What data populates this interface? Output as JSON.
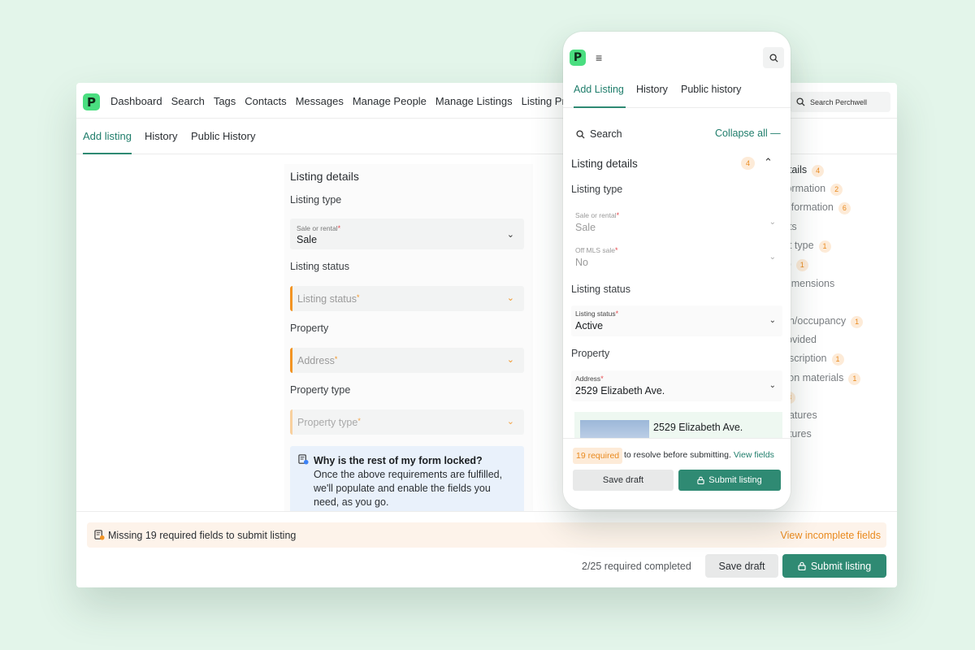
{
  "desktop": {
    "logo_letter": "P",
    "nav": [
      "Dashboard",
      "Search",
      "Tags",
      "Contacts",
      "Messages",
      "Manage People",
      "Manage Listings",
      "Listing Pres"
    ],
    "search_placeholder": "Search Perchwell",
    "tabs": [
      "Add listing",
      "History",
      "Public History"
    ],
    "form": {
      "heading": "Listing details",
      "listing_type_label": "Listing type",
      "sale_or_rental_small": "Sale or rental",
      "sale_or_rental_value": "Sale",
      "listing_status_label": "Listing status",
      "listing_status_placeholder": "Listing status",
      "property_label": "Property",
      "address_placeholder": "Address",
      "property_type_label": "Property type",
      "property_type_placeholder": "Property type",
      "info_title": "Why is the rest of my form locked?",
      "info_body": "Once the above requirements are fulfilled, we'll populate and enable the fields you need, as you go."
    },
    "right_list": [
      {
        "label": "etails",
        "badge": "4"
      },
      {
        "label": "formation",
        "badge": "2"
      },
      {
        "label": "information",
        "badge": "6"
      },
      {
        "label": "nts",
        "badge": ""
      },
      {
        "label": "nt type",
        "badge": "1"
      },
      {
        "label": "ip",
        "badge": "1"
      },
      {
        "label": "dimensions",
        "badge": ""
      },
      {
        "label": "on/occupancy",
        "badge": "1"
      },
      {
        "label": "rovided",
        "badge": ""
      },
      {
        "label": "escription",
        "badge": "1"
      },
      {
        "label": "tion materials",
        "badge": "1"
      },
      {
        "label": "",
        "badge": "3"
      },
      {
        "label": "eatures",
        "badge": ""
      },
      {
        "label": "atures",
        "badge": ""
      }
    ],
    "bottom": {
      "missing_text": "Missing 19 required fields to submit listing",
      "view_incomplete": "View incomplete fields",
      "progress": "2/25 required completed",
      "save_draft": "Save draft",
      "submit": "Submit listing"
    }
  },
  "phone": {
    "logo_letter": "P",
    "tabs": [
      "Add Listing",
      "History",
      "Public history"
    ],
    "search_label": "Search",
    "collapse_all": "Collapse all",
    "section_title": "Listing details",
    "section_badge": "4",
    "listing_type_label": "Listing type",
    "sale_or_rental_small": "Sale or rental",
    "sale_or_rental_value": "Sale",
    "off_mls_small": "Off MLS sale",
    "off_mls_value": "No",
    "listing_status_label": "Listing status",
    "listing_status_small": "Listing status",
    "listing_status_value": "Active",
    "property_label": "Property",
    "address_small": "Address",
    "address_value": "2529 Elizabeth Ave.",
    "card_title": "2529 Elizabeth Ave.",
    "required_badge": "19 required",
    "required_text": "to resolve before submitting.",
    "view_fields": "View fields",
    "save_draft": "Save draft",
    "submit": "Submit listing"
  },
  "colors": {
    "brand_green": "#4ade80",
    "accent_teal": "#2f8a73",
    "warning_orange": "#f29423",
    "background": "#e3f5ea"
  }
}
